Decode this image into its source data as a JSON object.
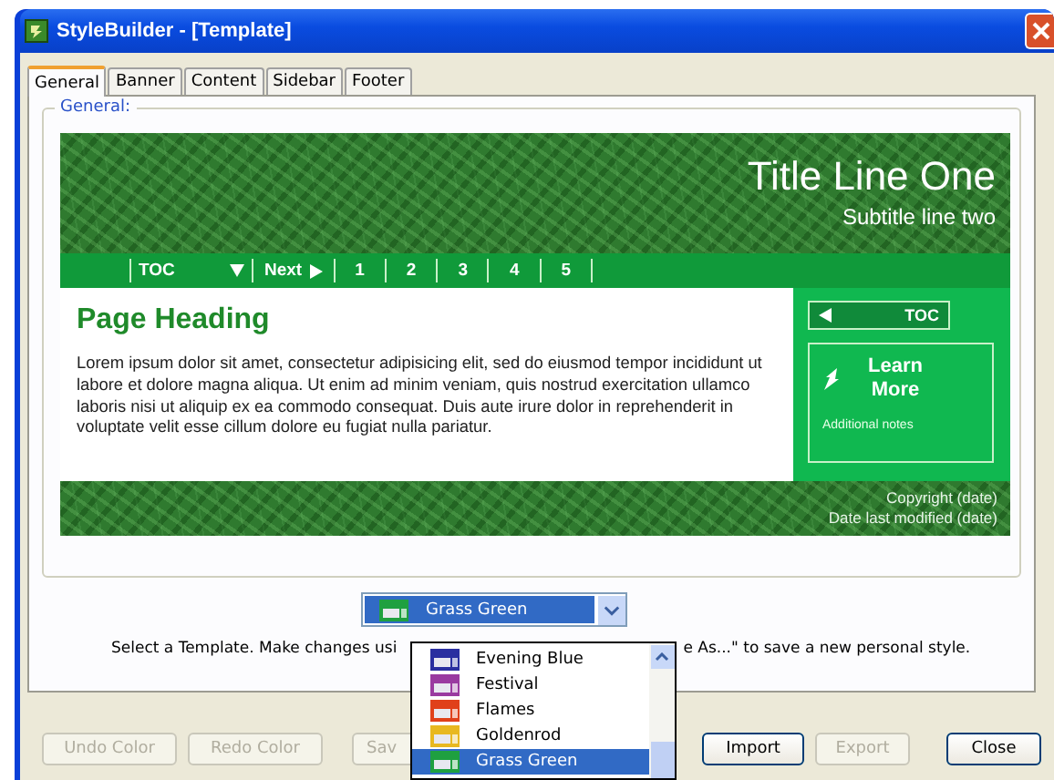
{
  "window": {
    "title": "StyleBuilder - [Template]"
  },
  "tabs": [
    {
      "label": "General",
      "selected": true
    },
    {
      "label": "Banner",
      "selected": false
    },
    {
      "label": "Content",
      "selected": false
    },
    {
      "label": "Sidebar",
      "selected": false
    },
    {
      "label": "Footer",
      "selected": false
    }
  ],
  "group": {
    "label": "General:"
  },
  "preview": {
    "title": "Title Line One",
    "subtitle": "Subtitle line two",
    "nav": [
      {
        "kind": "dropdown",
        "label": "TOC"
      },
      {
        "kind": "next",
        "label": "Next"
      },
      {
        "kind": "page",
        "label": "1"
      },
      {
        "kind": "page",
        "label": "2"
      },
      {
        "kind": "page",
        "label": "3"
      },
      {
        "kind": "page",
        "label": "4"
      },
      {
        "kind": "page",
        "label": "5"
      }
    ],
    "heading": "Page Heading",
    "body": "Lorem ipsum dolor sit amet, consectetur adipisicing elit, sed do eiusmod tempor incididunt ut labore et dolore magna aliqua. Ut enim ad minim veniam, quis nostrud exercitation ullamco laboris nisi ut aliquip ex ea commodo consequat. Duis aute irure dolor in reprehenderit in voluptate velit esse cillum dolore eu fugiat nulla pariatur.",
    "sidebar": {
      "toc": "TOC",
      "learn_more": "Learn More",
      "notes": "Additional notes"
    },
    "footer": [
      "Copyright (date)",
      "Date last modified (date)"
    ]
  },
  "template_select": {
    "value": "Grass Green",
    "color": "#1fa040",
    "options": [
      {
        "label": "Evening Blue",
        "color": "#2a2fa0",
        "selected": false
      },
      {
        "label": "Festival",
        "color": "#9a3aa0",
        "selected": false
      },
      {
        "label": "Flames",
        "color": "#e0401a",
        "selected": false
      },
      {
        "label": "Goldenrod",
        "color": "#e8b820",
        "selected": false
      },
      {
        "label": "Grass Green",
        "color": "#1fa040",
        "selected": true
      }
    ]
  },
  "instructions": [
    "Select a Template. Make changes usi",
    "e As...\" to save a new personal style."
  ],
  "buttons": [
    {
      "label": "Undo Color",
      "disabled": true
    },
    {
      "label": "Redo Color",
      "disabled": true
    },
    {
      "label": "Sav",
      "disabled": true
    },
    {
      "label": "Import",
      "disabled": false
    },
    {
      "label": "Export",
      "disabled": true
    },
    {
      "label": "Close",
      "disabled": false
    }
  ]
}
